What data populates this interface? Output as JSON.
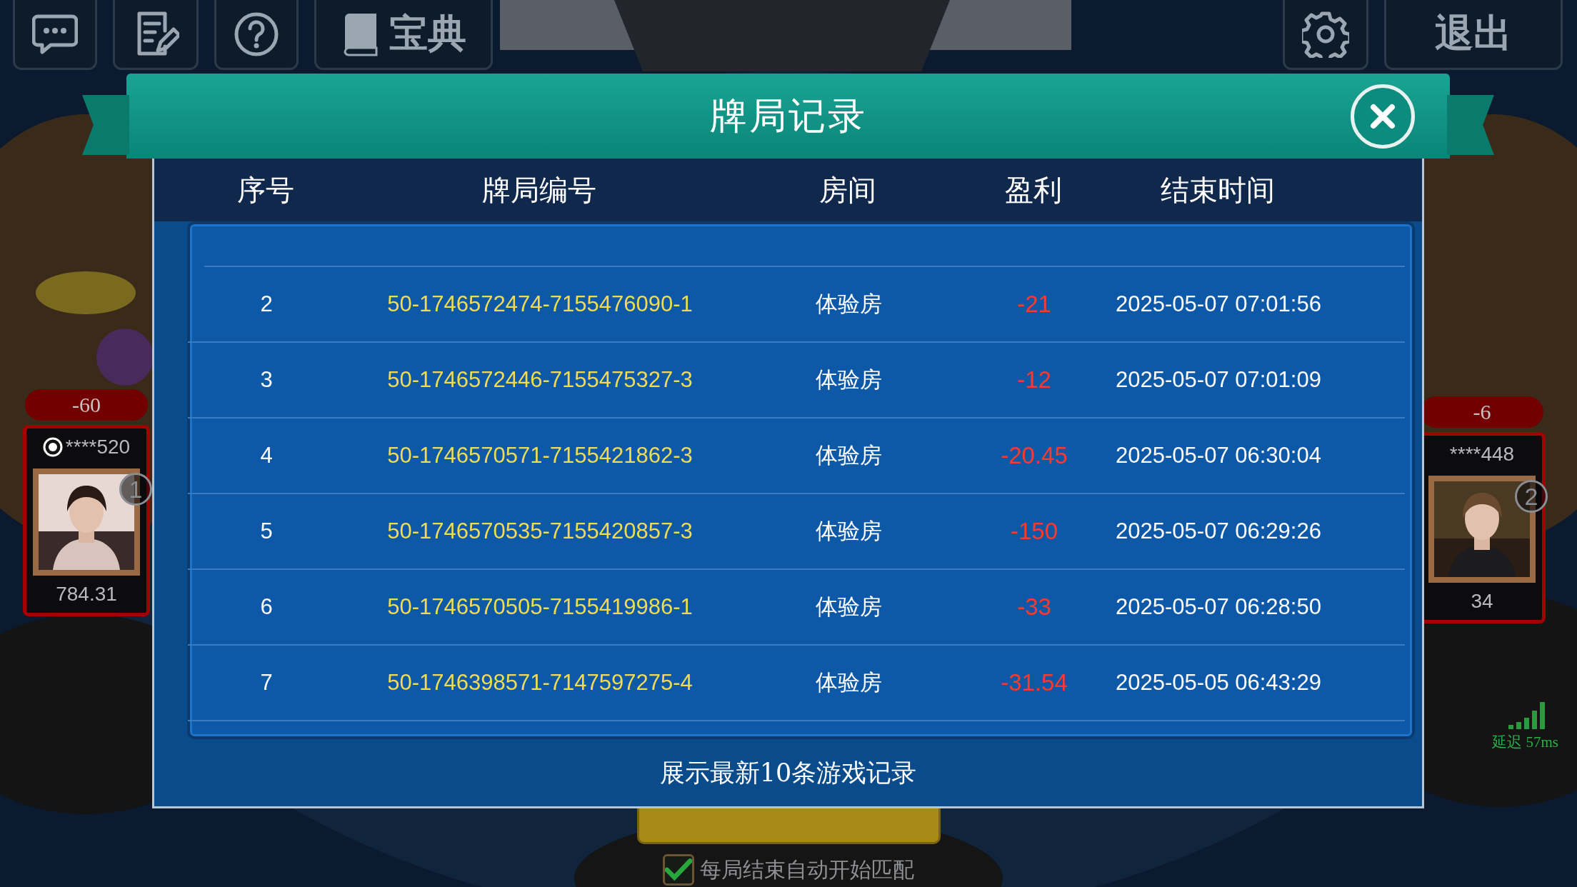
{
  "toolbar": {
    "left_buttons": [
      {
        "kind": "chat"
      },
      {
        "kind": "notes"
      },
      {
        "kind": "help"
      },
      {
        "kind": "guide",
        "label": "宝典"
      }
    ],
    "right_buttons": [
      {
        "kind": "settings"
      },
      {
        "kind": "exit",
        "label": "退出"
      }
    ]
  },
  "players": [
    {
      "change": "-60",
      "name": "****520",
      "balance": "784.31",
      "seat": "1",
      "dealer": true
    },
    {
      "change": "-6",
      "name": "****448",
      "balance": "34",
      "seat": "2",
      "dealer": false
    }
  ],
  "latency": {
    "label": "延迟 57ms"
  },
  "dialog": {
    "title": "牌局记录",
    "columns": [
      "序号",
      "牌局编号",
      "房间",
      "盈利",
      "结束时间"
    ],
    "rows": [
      {
        "seq": "2",
        "id": "50-1746572474-7155476090-1",
        "room": "体验房",
        "profit": "-21",
        "end_time": "2025-05-07 07:01:56"
      },
      {
        "seq": "3",
        "id": "50-1746572446-7155475327-3",
        "room": "体验房",
        "profit": "-12",
        "end_time": "2025-05-07 07:01:09"
      },
      {
        "seq": "4",
        "id": "50-1746570571-7155421862-3",
        "room": "体验房",
        "profit": "-20.45",
        "end_time": "2025-05-07 06:30:04"
      },
      {
        "seq": "5",
        "id": "50-1746570535-7155420857-3",
        "room": "体验房",
        "profit": "-150",
        "end_time": "2025-05-07 06:29:26"
      },
      {
        "seq": "6",
        "id": "50-1746570505-7155419986-1",
        "room": "体验房",
        "profit": "-33",
        "end_time": "2025-05-07 06:28:50"
      },
      {
        "seq": "7",
        "id": "50-1746398571-7147597275-4",
        "room": "体验房",
        "profit": "-31.54",
        "end_time": "2025-05-05 06:43:29"
      }
    ],
    "footer": "展示最新10条游戏记录"
  },
  "auto_match": {
    "label": "每局结束自动开始匹配",
    "checked": true
  }
}
